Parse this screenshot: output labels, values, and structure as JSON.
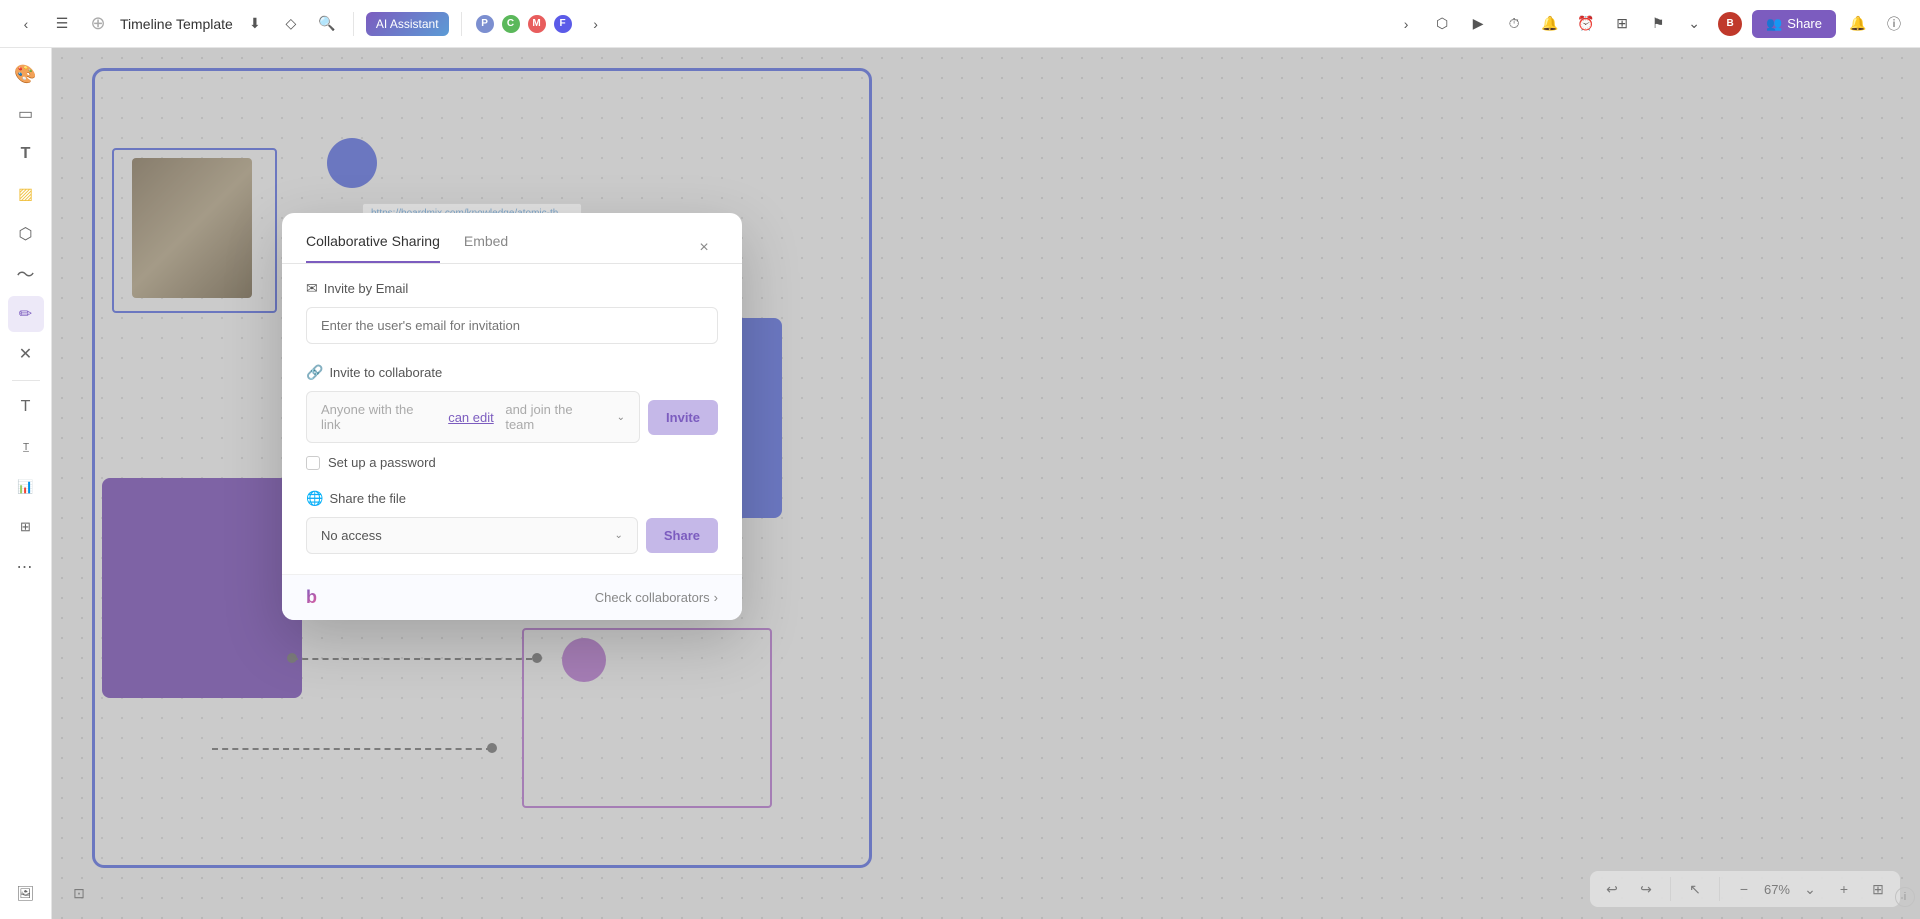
{
  "toolbar": {
    "back_icon": "‹",
    "menu_icon": "☰",
    "title": "Timeline Template",
    "download_icon": "⬇",
    "tag_icon": "🏷",
    "search_icon": "🔍",
    "ai_assistant_label": "AI Assistant",
    "share_label": "Share",
    "more_icon": "›",
    "history_icon": "⏱",
    "play_icon": "▶",
    "invite_icon": "👥",
    "notification_icon": "🔔",
    "help_icon": "ⓘ"
  },
  "sidebar": {
    "items": [
      {
        "icon": "🎨",
        "name": "color-palette"
      },
      {
        "icon": "▭",
        "name": "frame"
      },
      {
        "icon": "T",
        "name": "text"
      },
      {
        "icon": "🟡",
        "name": "sticky-note"
      },
      {
        "icon": "⬡",
        "name": "shape"
      },
      {
        "icon": "〜",
        "name": "pen"
      },
      {
        "icon": "✏",
        "name": "pencil"
      },
      {
        "icon": "✕",
        "name": "eraser"
      },
      {
        "icon": "━",
        "name": "line-divider"
      },
      {
        "icon": "T",
        "name": "text-tool"
      },
      {
        "icon": "T",
        "name": "text-style"
      },
      {
        "icon": "📊",
        "name": "chart"
      },
      {
        "icon": "⊞",
        "name": "grid"
      },
      {
        "icon": "⋯",
        "name": "more-tools"
      },
      {
        "icon": "🖼",
        "name": "gallery"
      }
    ]
  },
  "canvas": {
    "link_url": "https://boardmix.com/knowledge/atomic-theory-timeline-project/",
    "zoom_level": "67%",
    "zoom_label": "67%"
  },
  "modal": {
    "title": "Collaborative Sharing",
    "tab_embed": "Embed",
    "tab_collaborative": "Collaborative Sharing",
    "close_icon": "×",
    "invite_by_email_label": "Invite by Email",
    "email_placeholder": "Enter the user's email for invitation",
    "invite_to_collaborate_label": "Invite to collaborate",
    "link_text_prefix": "Anyone with the link",
    "link_text_editable": "can edit",
    "link_text_suffix": "and join the team",
    "invite_button_label": "Invite",
    "chevron_icon": "⌄",
    "password_label": "Set up a password",
    "share_file_label": "Share the file",
    "no_access_label": "No access",
    "share_button_label": "Share",
    "footer_logo": "b",
    "check_collaborators_label": "Check collaborators",
    "check_collaborators_arrow": "›"
  },
  "bottom_toolbar": {
    "undo_icon": "↩",
    "redo_icon": "↪",
    "zoom_out": "−",
    "zoom_level": "67%",
    "zoom_in": "+",
    "fit_icon": "⊞",
    "cursor_icon": "↖"
  }
}
